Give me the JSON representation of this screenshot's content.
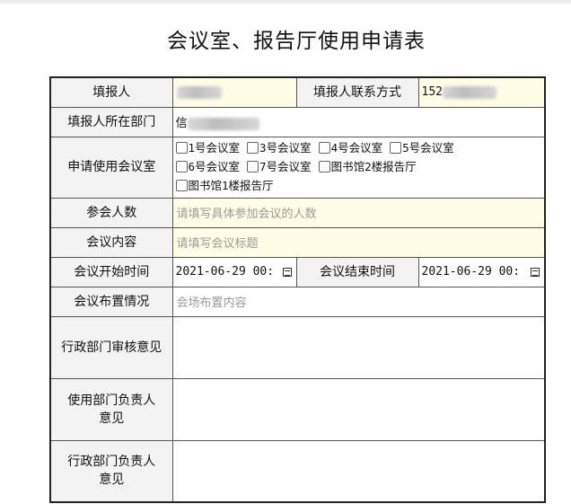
{
  "title": "会议室、报告厅使用申请表",
  "labels": {
    "applicant": "填报人",
    "contact": "填报人联系方式",
    "department": "填报人所在部门",
    "rooms": "申请使用会议室",
    "attendees": "参会人数",
    "content": "会议内容",
    "start_time": "会议开始时间",
    "end_time": "会议结束时间",
    "arrangement": "会议布置情况",
    "admin_review": "行政部门审核意见",
    "user_dept_head": "使用部门负责人意见",
    "admin_dept_head": "行政部门负责人意见"
  },
  "values": {
    "contact_prefix": "152",
    "department_prefix": "信",
    "start_time": "2021-06-29 00:",
    "end_time": "2021-06-29 00:"
  },
  "placeholders": {
    "attendees": "请填写具体参加会议的人数",
    "content": "请填写会议标题",
    "arrangement": "会场布置内容"
  },
  "rooms": [
    "1号会议室",
    "3号会议室",
    "4号会议室",
    "5号会议室",
    "6号会议室",
    "7号会议室",
    "图书馆2楼报告厅",
    "图书馆1楼报告厅"
  ],
  "icons": {
    "datetime_picker": "calendar-icon"
  }
}
